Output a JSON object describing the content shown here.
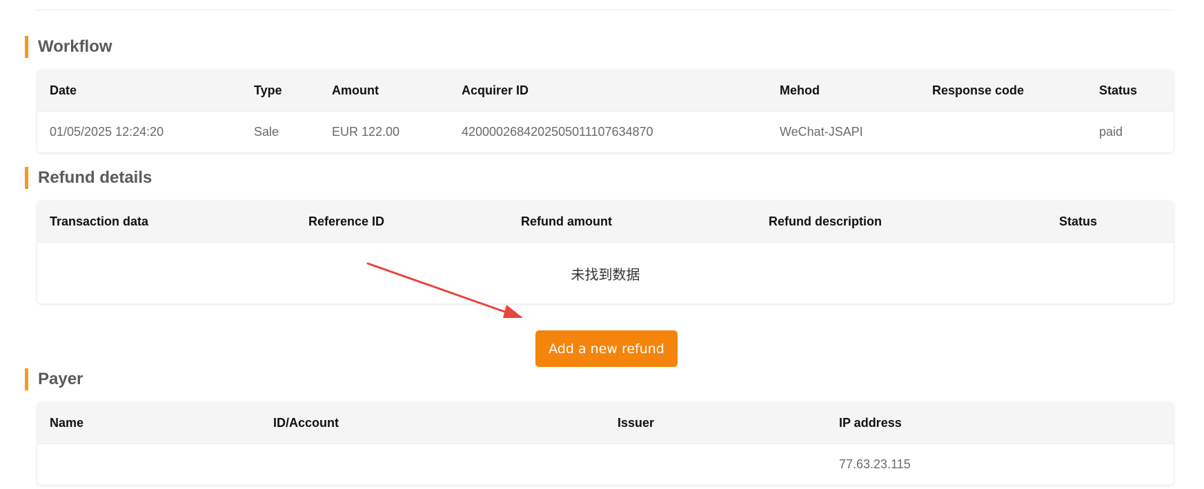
{
  "workflow": {
    "title": "Workflow",
    "headers": [
      "Date",
      "Type",
      "Amount",
      "Acquirer ID",
      "Mehod",
      "Response code",
      "Status"
    ],
    "rows": [
      [
        "01/05/2025 12:24:20",
        "Sale",
        "EUR 122.00",
        "4200002684202505011107634870",
        "WeChat-JSAPI",
        "",
        "paid"
      ]
    ]
  },
  "refund": {
    "title": "Refund details",
    "headers": [
      "Transaction data",
      "Reference ID",
      "Refund amount",
      "Refund description",
      "Status"
    ],
    "empty_text": "未找到数据",
    "add_button": "Add a new refund"
  },
  "payer": {
    "title": "Payer",
    "headers": [
      "Name",
      "ID/Account",
      "Issuer",
      "IP address"
    ],
    "rows": [
      [
        "",
        "",
        "",
        "77.63.23.115"
      ]
    ]
  },
  "colors": {
    "accent": "#f5840c",
    "section_bar": "#f39a1f",
    "annotation_arrow": "#e8453c"
  }
}
